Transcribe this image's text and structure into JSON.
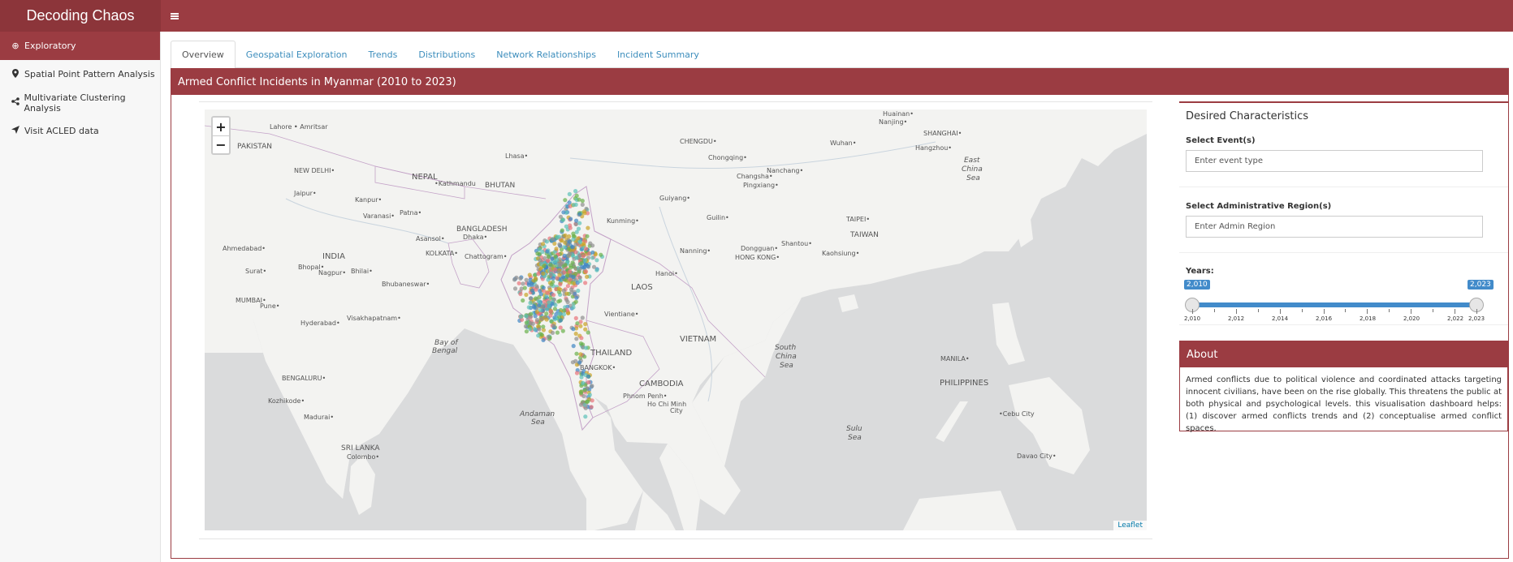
{
  "app": {
    "title": "Decoding Chaos"
  },
  "sidebar": {
    "items": [
      {
        "label": "Exploratory",
        "icon": "globe-icon",
        "glyph": "⊕"
      },
      {
        "label": "Spatial Point Pattern Analysis",
        "icon": "map-marker-icon",
        "glyph": "⬤"
      },
      {
        "label": "Multivariate Clustering Analysis",
        "icon": "share-icon",
        "glyph": "⋖"
      },
      {
        "label": "Visit ACLED data",
        "icon": "send-icon",
        "glyph": "➤"
      }
    ]
  },
  "tabs": [
    {
      "label": "Overview"
    },
    {
      "label": "Geospatial Exploration"
    },
    {
      "label": "Trends"
    },
    {
      "label": "Distributions"
    },
    {
      "label": "Network Relationships"
    },
    {
      "label": "Incident Summary"
    }
  ],
  "main_box": {
    "title": "Armed Conflict Incidents in Myanmar (2010 to 2023)"
  },
  "map": {
    "zoom_in": "+",
    "zoom_out": "−",
    "attribution": "Leaflet",
    "labels": {
      "pakistan": "PAKISTAN",
      "lahore": "Lahore •",
      "amritsar": "• Amritsar",
      "new_delhi": "NEW DELHI•",
      "jaipur": "Jaipur•",
      "kanpur": "Kanpur•",
      "nepal": "NEPAL",
      "kathmandu": "•Kathmandu",
      "bhutan": "BHUTAN",
      "lhasa": "Lhasa•",
      "chengdu": "CHENGDU•",
      "chongqing": "Chongqing•",
      "wuhan": "Wuhan•",
      "nanjing": "Nanjing•",
      "huainan": "Huainan•",
      "shanghai": "SHANGHAI•",
      "hangzhou": "Hangzhou•",
      "east_china_sea_1": "East",
      "east_china_sea_2": "China",
      "east_china_sea_3": "Sea",
      "varanasi": "Varanasi•",
      "patna": "Patna•",
      "asansol": "Asansol•",
      "bangladesh": "BANGLADESH",
      "dhaka": "Dhaka•",
      "kolkata": "KOLKATA•",
      "chattogram": "Chattogram•",
      "ahmedabad": "Ahmedabad•",
      "bhopal": "Bhopal•",
      "india": "INDIA",
      "surat": "Surat•",
      "nagpur": "Nagpur•",
      "bhilai": "Bhilai•",
      "bhubaneswar": "Bhubaneswar•",
      "mumbai": "MUMBAI•",
      "pune": "Pune•",
      "hyderabad": "Hyderabad•",
      "visakhapatnam": "Visakhapatnam•",
      "bay_of_bengal_1": "Bay of",
      "bay_of_bengal_2": "Bengal",
      "bengaluru": "BENGALURU•",
      "kozhikode": "Kozhikode•",
      "madurai": "Madurai•",
      "sri_lanka": "SRI LANKA",
      "colombo": "Colombo•",
      "andaman_sea_1": "Andaman",
      "andaman_sea_2": "Sea",
      "kunming": "Kunming•",
      "guiyang": "Guiyang•",
      "guilin": "Guilin•",
      "changsha": "Changsha•",
      "pingxiang": "Pingxiang•",
      "nanchang": "Nanchang•",
      "taipei": "TAIPEI•",
      "taiwan": "TAIWAN",
      "kaohsiung": "Kaohsiung•",
      "shantou": "Shantou•",
      "dongguan": "Dongguan•",
      "hong_kong": "HONG KONG•",
      "nanning": "Nanning•",
      "hanoi": "Hanoi•",
      "laos": "LAOS",
      "vientiane": "Vientiane•",
      "thailand": "THAILAND",
      "bangkok": "BANGKOK•",
      "vietnam": "VIETNAM",
      "cambodia": "CAMBODIA",
      "phnom_penh": "Phnom Penh•",
      "ho_chi_minh": "Ho Chi Minh",
      "city": "City",
      "south_china_sea_1": "South",
      "south_china_sea_2": "China",
      "south_china_sea_3": "Sea",
      "manila": "MANILA•",
      "philippines": "PHILIPPINES",
      "cebu": "•Cebu City",
      "sulu_sea_1": "Sulu",
      "sulu_sea_2": "Sea",
      "davao": "Davao City•"
    }
  },
  "controls": {
    "title": "Desired Characteristics",
    "event_label": "Select Event(s)",
    "event_placeholder": "Enter event type",
    "region_label": "Select Administrative Region(s)",
    "region_placeholder": "Enter Admin Region",
    "years_label": "Years:",
    "year_min": "2,010",
    "year_max": "2,023",
    "tick_labels": [
      "2,010",
      "2,012",
      "2,014",
      "2,016",
      "2,018",
      "2,020",
      "2,022",
      "2,023"
    ]
  },
  "about": {
    "title": "About",
    "text": "Armed conflicts due to political violence and coordinated attacks targeting innocent civilians, have been on the rise globally. This threatens the public at both physical and psychological levels. this visualisation dashboard helps: (1) discover armed conflicts trends and (2) conceptualise armed conflict spaces."
  },
  "colors": {
    "brand": "#9b3c42",
    "brand_dark": "#8c353a",
    "accent": "#428bca",
    "incident_colors": [
      "#e8737a",
      "#5bc0b8",
      "#8f8f8f",
      "#c9a227",
      "#3f86c4",
      "#6ab04c"
    ]
  }
}
